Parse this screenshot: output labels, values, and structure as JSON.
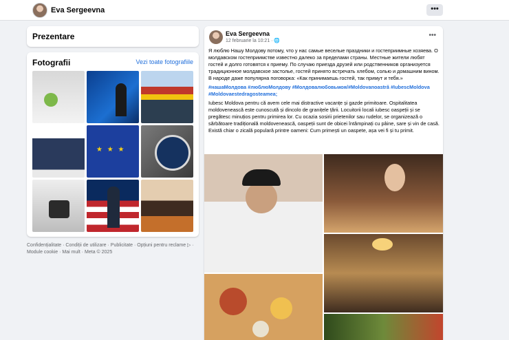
{
  "topbar": {
    "profile_name": "Eva Sergeevna",
    "more_label": "•••"
  },
  "intro": {
    "title": "Prezentare"
  },
  "photos": {
    "title": "Fotografii",
    "see_all": "Vezi toate fotografiile"
  },
  "footer": {
    "text": "Confidențialitate · Condiții de utilizare · Publicitate · Opțiuni pentru reclame ▷ · Module cookie · Mai mult · Meta © 2025"
  },
  "post": {
    "author": "Eva Sergeevna",
    "date": "12 februarie la 10:21 · 🌐",
    "menu": "•••",
    "text_ru": "Я люблю Нашу Молдову потому, что у нас самые веселые праздники и гостеприимные хозяева. О молдавском гостеприимстве известно далеко за пределами страны. Местные жители любят гостей и долго готовятся к приему. По случаю приезда друзей или родственников организуется традиционное молдавское застолье, гостей принято встречать хлебом, солью и домашним вином. В народе даже популярна поговорка: «Как принимаешь гостей, так примут и тебя.»",
    "hashtags": "#нашаМолдова #люблюМолдову #Молдовалюбовьмоя/#Moldovanoastră #IubescMoldova #Moldovaestedragosteamea;",
    "text_ro": "Iubesc Moldova pentru că avem cele mai distractive vacanțe și gazde primitoare.  Ospitalitatea moldovenească este cunoscută și dincolo de granițele țării.  Locuitorii locali iubesc oaspeții și se pregătesc minuțios pentru primirea lor.  Cu ocazia sosirii prietenilor sau rudelor, se organizează o sărbătoare tradițională moldovenească, oaspeții sunt de obicei întâmpinați cu pâine, sare și vin de casă.   Există chiar o zicală populară printre oameni: Cum primești un oaspete, așa vei fi și tu primit."
  }
}
